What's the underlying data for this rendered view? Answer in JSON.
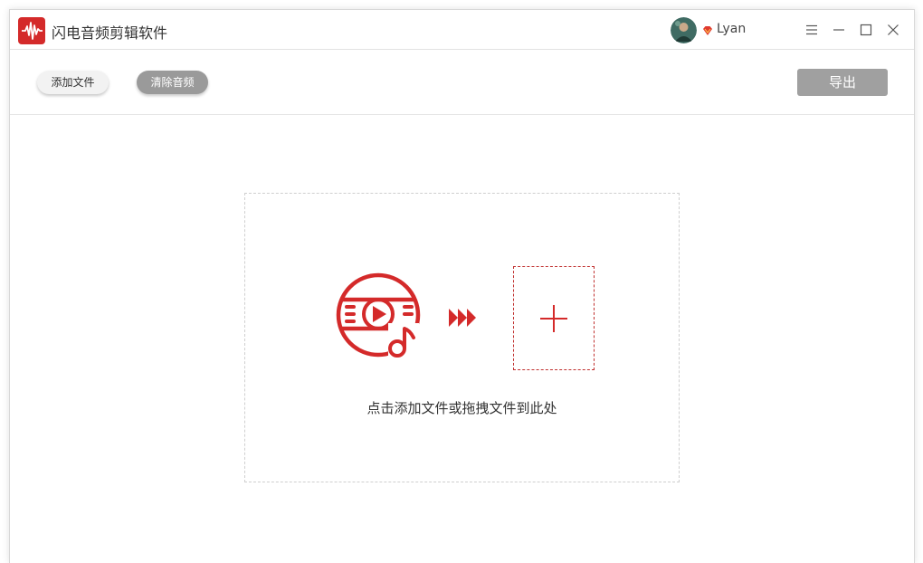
{
  "app": {
    "title": "闪电音频剪辑软件",
    "logo_icon": "audio-wave-logo-icon",
    "brand_color": "#d42a2a"
  },
  "user": {
    "name": "Lyan",
    "badge_icon": "vip-diamond-icon"
  },
  "window_controls": [
    "menu-icon",
    "minimize-icon",
    "maximize-icon",
    "close-icon"
  ],
  "toolbar": {
    "add_file_label": "添加文件",
    "clear_audio_label": "清除音频",
    "export_label": "导出"
  },
  "drop_zone": {
    "hint": "点击添加文件或拖拽文件到此处",
    "media_icon": "video-music-icon",
    "arrow_icon": "forward-arrows-icon",
    "add_icon": "plus-icon"
  }
}
